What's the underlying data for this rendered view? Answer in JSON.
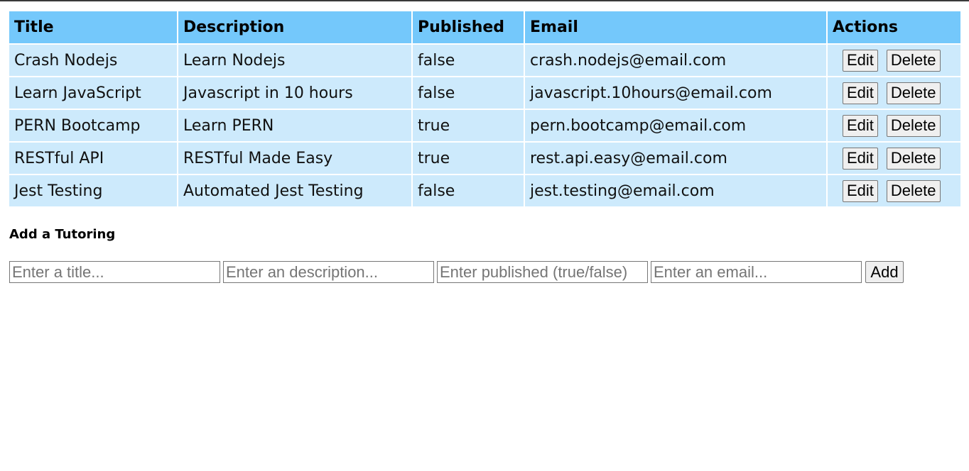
{
  "table": {
    "headers": [
      "Title",
      "Description",
      "Published",
      "Email",
      "Actions"
    ],
    "rows": [
      {
        "title": "Crash Nodejs",
        "description": "Learn Nodejs",
        "published": "false",
        "email": "crash.nodejs@email.com"
      },
      {
        "title": "Learn JavaScript",
        "description": "Javascript in 10 hours",
        "published": "false",
        "email": "javascript.10hours@email.com"
      },
      {
        "title": "PERN Bootcamp",
        "description": "Learn PERN",
        "published": "true",
        "email": "pern.bootcamp@email.com"
      },
      {
        "title": "RESTful API",
        "description": "RESTful Made Easy",
        "published": "true",
        "email": "rest.api.easy@email.com"
      },
      {
        "title": "Jest Testing",
        "description": "Automated Jest Testing",
        "published": "false",
        "email": "jest.testing@email.com"
      }
    ],
    "edit_label": "Edit",
    "delete_label": "Delete"
  },
  "add_form": {
    "heading": "Add a Tutoring",
    "title_placeholder": "Enter a title...",
    "description_placeholder": "Enter an description...",
    "published_placeholder": "Enter published (true/false)",
    "email_placeholder": "Enter an email...",
    "add_label": "Add"
  },
  "colors": {
    "header_bg": "#74c8fb",
    "row_bg": "#cdeafc"
  }
}
